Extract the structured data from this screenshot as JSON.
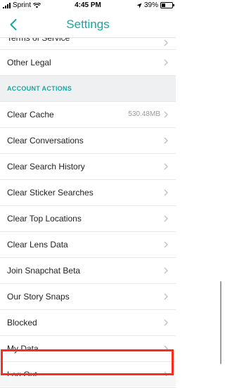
{
  "status_bar": {
    "carrier": "Sprint",
    "time": "4:45 PM",
    "battery_percent": "39%",
    "battery_level": 0.39
  },
  "header": {
    "title": "Settings"
  },
  "rows": {
    "terms_partial": "Terms of Service",
    "other_legal": "Other Legal",
    "section_account_actions": "ACCOUNT ACTIONS",
    "clear_cache": "Clear Cache",
    "clear_cache_value": "530.48MB",
    "clear_conversations": "Clear Conversations",
    "clear_search_history": "Clear Search History",
    "clear_sticker_searches": "Clear Sticker Searches",
    "clear_top_locations": "Clear Top Locations",
    "clear_lens_data": "Clear Lens Data",
    "join_snapchat_beta": "Join Snapchat Beta",
    "our_story_snaps": "Our Story Snaps",
    "blocked": "Blocked",
    "my_data": "My Data",
    "log_out": "Log Out"
  },
  "colors": {
    "accent": "#14a8a0",
    "highlight": "#ff2a1a"
  }
}
